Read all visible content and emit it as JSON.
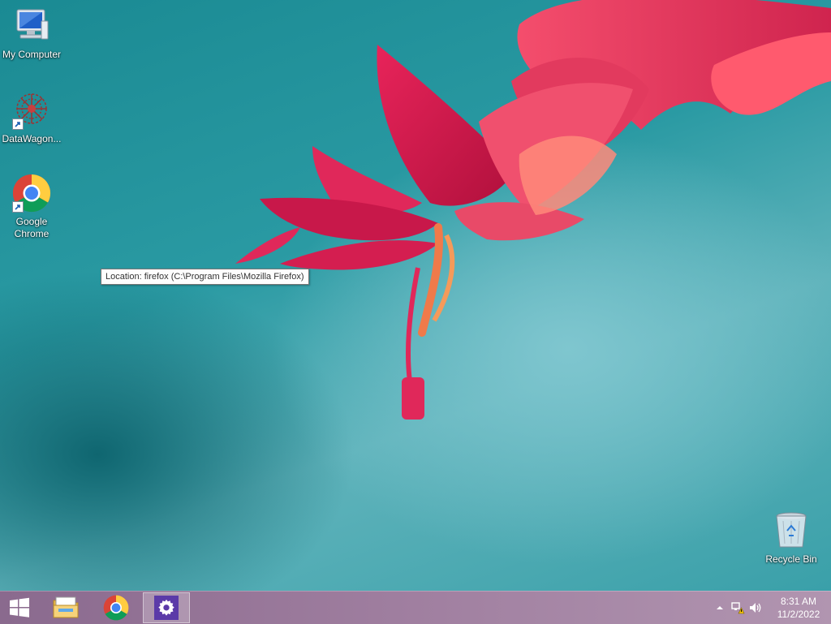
{
  "desktop": {
    "icons": [
      {
        "label": "My Computer",
        "icon": "computer-icon"
      },
      {
        "label": "DataWagon...",
        "icon": "datawagon-icon"
      },
      {
        "label": "Google Chrome",
        "icon": "chrome-icon"
      },
      {
        "label": "Recycle Bin",
        "icon": "recycle-bin-icon"
      }
    ],
    "tooltip": "Location: firefox (C:\\Program Files\\Mozilla Firefox)"
  },
  "taskbar": {
    "start": "windows-start-icon",
    "pinned": [
      {
        "name": "file-explorer",
        "icon": "folder-icon"
      },
      {
        "name": "google-chrome",
        "icon": "chrome-icon"
      },
      {
        "name": "settings",
        "icon": "gear-icon",
        "active": true
      }
    ],
    "tray": {
      "icons": [
        "show-hidden-icons-icon",
        "network-warning-icon",
        "volume-icon"
      ],
      "time": "8:31 AM",
      "date": "11/2/2022"
    }
  },
  "colors": {
    "taskbar": "#a07fa0",
    "settings_tile": "#5b3aa8",
    "desktop_teal": "#2a9aa3"
  }
}
